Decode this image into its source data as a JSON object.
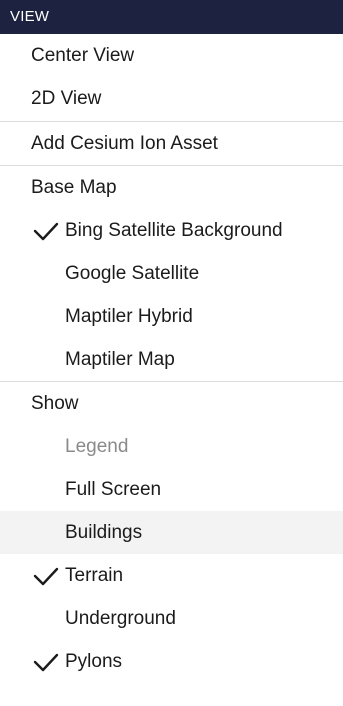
{
  "menu": {
    "header": "VIEW",
    "items": [
      {
        "label": "Center View"
      },
      {
        "label": "2D View"
      },
      {
        "label": "Add Cesium Ion Asset"
      },
      {
        "label": "Base Map"
      },
      {
        "label": "Bing Satellite Background",
        "checked": true
      },
      {
        "label": "Google Satellite"
      },
      {
        "label": "Maptiler Hybrid"
      },
      {
        "label": "Maptiler Map"
      },
      {
        "label": "Show"
      },
      {
        "label": "Legend",
        "disabled": true
      },
      {
        "label": "Full Screen"
      },
      {
        "label": "Buildings",
        "hovered": true
      },
      {
        "label": "Terrain",
        "checked": true
      },
      {
        "label": "Underground"
      },
      {
        "label": "Pylons",
        "checked": true
      }
    ]
  },
  "colors": {
    "header_bg": "#1c2240",
    "header_text": "#ffffff",
    "disabled_text": "#8a8a8a",
    "hover_bg": "#f3f3f3",
    "divider": "#dcdcdc"
  },
  "icons": {
    "check": "checkmark-icon"
  }
}
